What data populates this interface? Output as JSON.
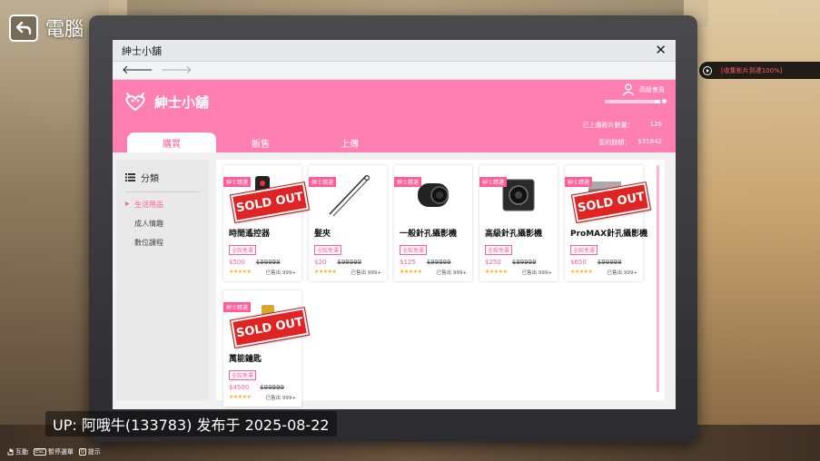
{
  "top": {
    "title": "電腦"
  },
  "window": {
    "title": "紳士小舖",
    "close": "✕"
  },
  "shop": {
    "name": "紳士小舖",
    "member_level": "高級會員",
    "member_progress": 0.85,
    "uploaded_label": "已上傳影片數量：",
    "uploaded_value": "126",
    "balance_label": "您的餘額：",
    "balance_value": "$31842"
  },
  "tabs": [
    {
      "label": "購買",
      "active": true
    },
    {
      "label": "販售",
      "active": false
    },
    {
      "label": "上傳",
      "active": false
    }
  ],
  "sidebar": {
    "heading": "分類",
    "items": [
      {
        "label": "生活用品",
        "active": true
      },
      {
        "label": "成人情趣",
        "active": false
      },
      {
        "label": "數位課程",
        "active": false
      }
    ]
  },
  "products": [
    {
      "tag": "紳士精選",
      "title": "時間遙控器",
      "badge": "全館免運",
      "price": "$500",
      "old_price": "$99999",
      "stars": "★★★★★",
      "sold": "已售出 999+",
      "sold_out": true,
      "sold_out_label": "SOLD OUT",
      "icon": "remote-control-icon"
    },
    {
      "tag": "紳士精選",
      "title": "髮夾",
      "badge": "全館免運",
      "price": "$20",
      "old_price": "$99999",
      "stars": "★★★★★",
      "sold": "已售出 999+",
      "sold_out": false,
      "sold_out_label": "",
      "icon": "hairpin-icon"
    },
    {
      "tag": "紳士精選",
      "title": "一般針孔攝影機",
      "badge": "全館免運",
      "price": "$125",
      "old_price": "$99999",
      "stars": "★★★★★",
      "sold": "已售出 999+",
      "sold_out": false,
      "sold_out_label": "",
      "icon": "pinhole-camera-icon"
    },
    {
      "tag": "紳士精選",
      "title": "高級針孔攝影機",
      "badge": "全館免運",
      "price": "$250",
      "old_price": "$99999",
      "stars": "★★★★★",
      "sold": "已售出 999+",
      "sold_out": false,
      "sold_out_label": "",
      "icon": "box-camera-icon"
    },
    {
      "tag": "紳士精選",
      "title": "ProMAX針孔攝影機",
      "badge": "全館免運",
      "price": "$650",
      "old_price": "$99999",
      "stars": "★★★★★",
      "sold": "已售出 999+",
      "sold_out": true,
      "sold_out_label": "SOLD OUT",
      "icon": "promax-camera-icon"
    },
    {
      "tag": "紳士精選",
      "title": "萬能鑰匙",
      "badge": "全館免運",
      "price": "$4500",
      "old_price": "$99999",
      "stars": "★★★★★",
      "sold": "已售出 999+",
      "sold_out": true,
      "sold_out_label": "SOLD OUT",
      "icon": "master-key-icon"
    }
  ],
  "quest": {
    "text": "[收集影片到達100%]"
  },
  "overlay": {
    "up_text": "UP: 阿哦牛(133783) 发布于 2025-08-22"
  },
  "hints": [
    {
      "key": "",
      "label": "互動",
      "icon": "hand-icon"
    },
    {
      "key": "ESC",
      "label": "暫停選單"
    },
    {
      "key": "Q",
      "label": "提示"
    }
  ],
  "colors": {
    "accent": "#ff7fb2",
    "accent_dark": "#ff5c99",
    "soldout": "#e02424"
  }
}
